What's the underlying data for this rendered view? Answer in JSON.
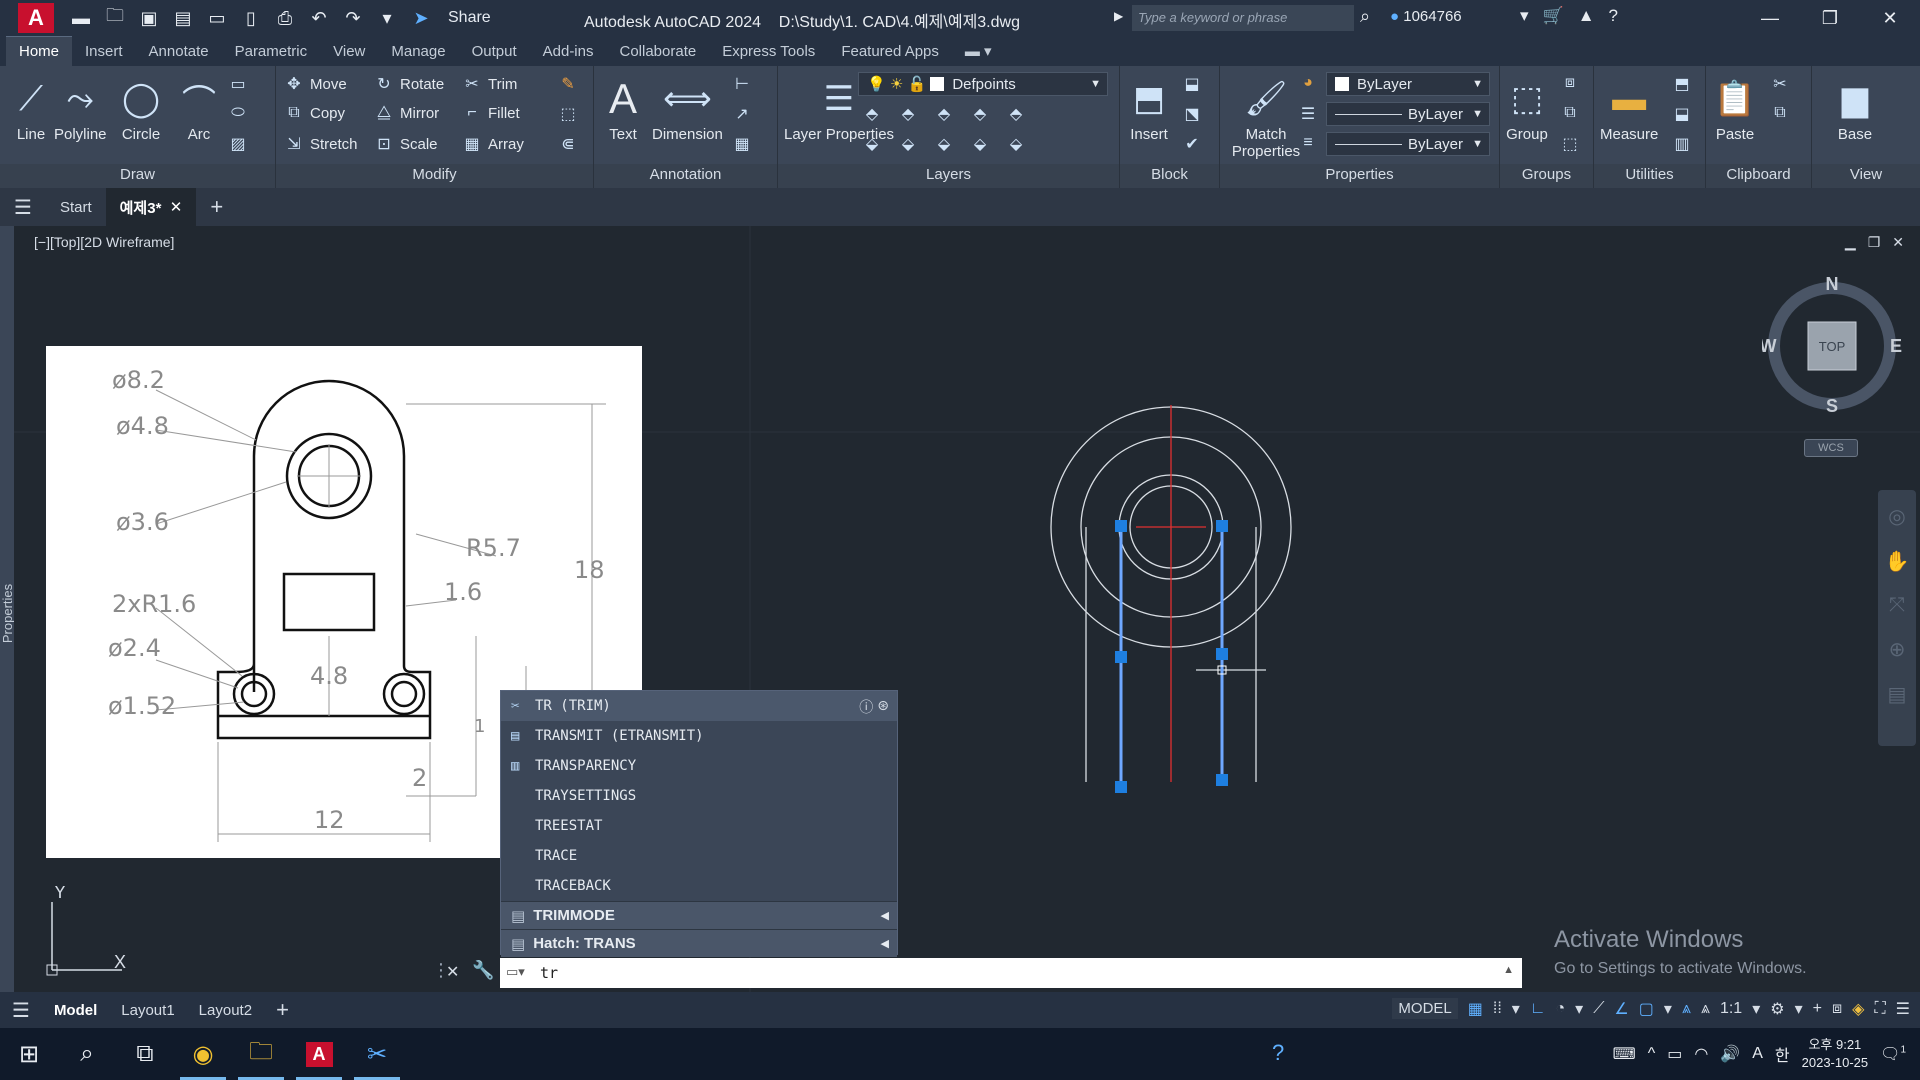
{
  "app": {
    "title": "Autodesk AutoCAD 2024",
    "file_path": "D:\\Study\\1. CAD\\4.예제\\예제3.dwg",
    "share_label": "Share",
    "search_placeholder": "Type a keyword or phrase",
    "user_id": "1064766"
  },
  "ribbon_tabs": [
    "Home",
    "Insert",
    "Annotate",
    "Parametric",
    "View",
    "Manage",
    "Output",
    "Add-ins",
    "Collaborate",
    "Express Tools",
    "Featured Apps"
  ],
  "ribbon": {
    "draw": {
      "title": "Draw",
      "line": "Line",
      "polyline": "Polyline",
      "circle": "Circle",
      "arc": "Arc"
    },
    "modify": {
      "title": "Modify",
      "move": "Move",
      "rotate": "Rotate",
      "trim": "Trim",
      "copy": "Copy",
      "mirror": "Mirror",
      "fillet": "Fillet",
      "stretch": "Stretch",
      "scale": "Scale",
      "array": "Array"
    },
    "annotation": {
      "title": "Annotation",
      "text": "Text",
      "dimension": "Dimension"
    },
    "layers": {
      "title": "Layers",
      "layer_properties": "Layer Properties",
      "current_layer": "Defpoints"
    },
    "block": {
      "title": "Block",
      "insert": "Insert"
    },
    "properties": {
      "title": "Properties",
      "match": "Match Properties",
      "color": "ByLayer",
      "linetype": "ByLayer",
      "lineweight": "ByLayer"
    },
    "groups": {
      "title": "Groups",
      "group": "Group"
    },
    "utilities": {
      "title": "Utilities",
      "measure": "Measure"
    },
    "clipboard": {
      "title": "Clipboard",
      "paste": "Paste"
    },
    "view": {
      "title": "View",
      "base": "Base"
    }
  },
  "file_tabs": {
    "start": "Start",
    "drawing": "예제3*"
  },
  "viewport": {
    "label": "[−][Top][2D Wireframe]",
    "compass": {
      "n": "N",
      "s": "S",
      "e": "E",
      "w": "W",
      "top": "TOP",
      "wcs": "WCS"
    },
    "ucs": {
      "x": "X",
      "y": "Y"
    }
  },
  "side_palette": "Properties",
  "reference_dims": {
    "d82": "ø8.2",
    "d48": "ø4.8",
    "d36": "ø3.6",
    "r16": "2xR1.6",
    "d24": "ø2.4",
    "d152": "ø1.52",
    "r57": "R5.7",
    "v16": "1.6",
    "h18": "18",
    "v48": "4.8",
    "h2": "2",
    "h12": "12",
    "h1": "1"
  },
  "autocomplete": {
    "items": [
      "TR (TRIM)",
      "TRANSMIT (ETRANSMIT)",
      "TRANSPARENCY",
      "TRAYSETTINGS",
      "TREESTAT",
      "TRACE",
      "TRACEBACK"
    ],
    "sections": [
      "TRIMMODE",
      "Hatch: TRANS"
    ]
  },
  "command": {
    "input": "tr"
  },
  "watermark": {
    "line1": "Activate Windows",
    "line2": "Go to Settings to activate Windows."
  },
  "layout_tabs": [
    "Model",
    "Layout1",
    "Layout2"
  ],
  "status": {
    "model": "MODEL",
    "scale": "1:1"
  },
  "taskbar": {
    "time": "오후 9:21",
    "date": "2023-10-25",
    "ime": "한",
    "lang": "A",
    "notif": "1"
  },
  "colors": {
    "bg": "#212830",
    "ribbon": "#3b4657",
    "accent": "#1e7fe0"
  }
}
